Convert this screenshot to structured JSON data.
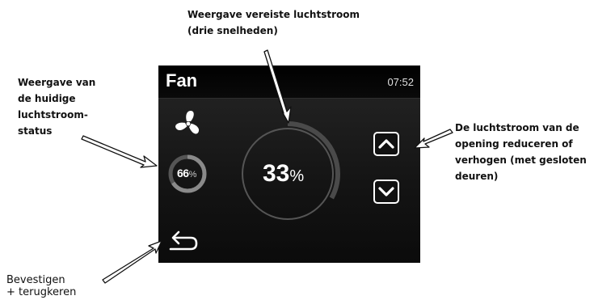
{
  "callouts": {
    "required_airflow": [
      "Weergave vereiste luchtstroom",
      "(drie snelheden)"
    ],
    "current_status": [
      "Weergave van",
      "de huidige",
      "luchtstroom-",
      "status"
    ],
    "adjust_opening": [
      "De luchtstroom van de",
      "opening reduceren of",
      "verhogen (met gesloten",
      "deuren)"
    ],
    "confirm_back": [
      "Bevestigen",
      "+ terugkeren"
    ]
  },
  "screen": {
    "title": "Fan",
    "clock": "07:52",
    "current_status": {
      "value": "66",
      "unit": "%",
      "fraction": 0.66
    },
    "required_airflow": {
      "value": "33",
      "unit": "%",
      "fraction": 0.33
    }
  },
  "icons": {
    "fan": "fan-icon",
    "up": "chevron-up-icon",
    "down": "chevron-down-icon",
    "back": "back-arrow-icon"
  },
  "colors": {
    "screen_bg": "#1a1a1a",
    "ring_track": "#555555",
    "text": "#ffffff"
  }
}
